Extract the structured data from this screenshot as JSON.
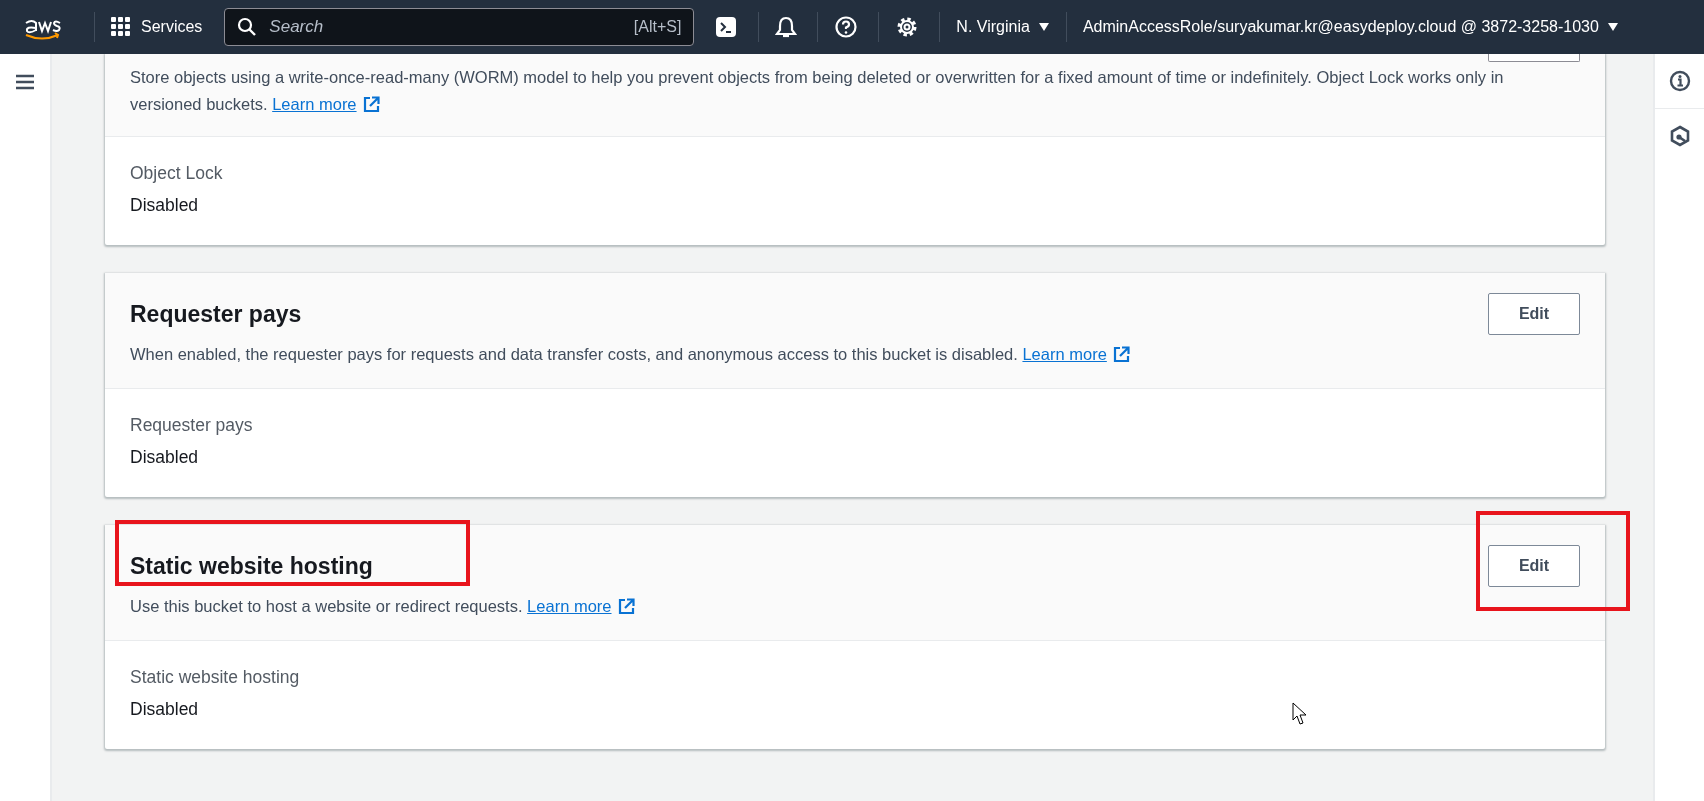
{
  "top_bar": {
    "services": "Services",
    "search": {
      "placeholder": "Search",
      "shortcut": "[Alt+S]"
    },
    "region": "N. Virginia",
    "account": "AdminAccessRole/suryakumar.kr@easydeploy.cloud @ 3872-3258-1030"
  },
  "cards": [
    {
      "kind": "clipped",
      "description": "Store objects using a write-once-read-many (WORM) model to help you prevent objects from being deleted or overwritten for a fixed amount of time or indefinitely. Object Lock works only in versioned buckets.",
      "link": "Learn more",
      "field_label": "Object Lock",
      "field_value": "Disabled"
    },
    {
      "kind": "full",
      "title": "Requester pays",
      "edit": "Edit",
      "description": "When enabled, the requester pays for requests and data transfer costs, and anonymous access to this bucket is disabled.",
      "link": "Learn more",
      "field_label": "Requester pays",
      "field_value": "Disabled"
    },
    {
      "kind": "full",
      "title": "Static website hosting",
      "edit": "Edit",
      "description": "Use this bucket to host a website or redirect requests.",
      "link": "Learn more",
      "field_label": "Static website hosting",
      "field_value": "Disabled",
      "highlighted": true
    }
  ]
}
